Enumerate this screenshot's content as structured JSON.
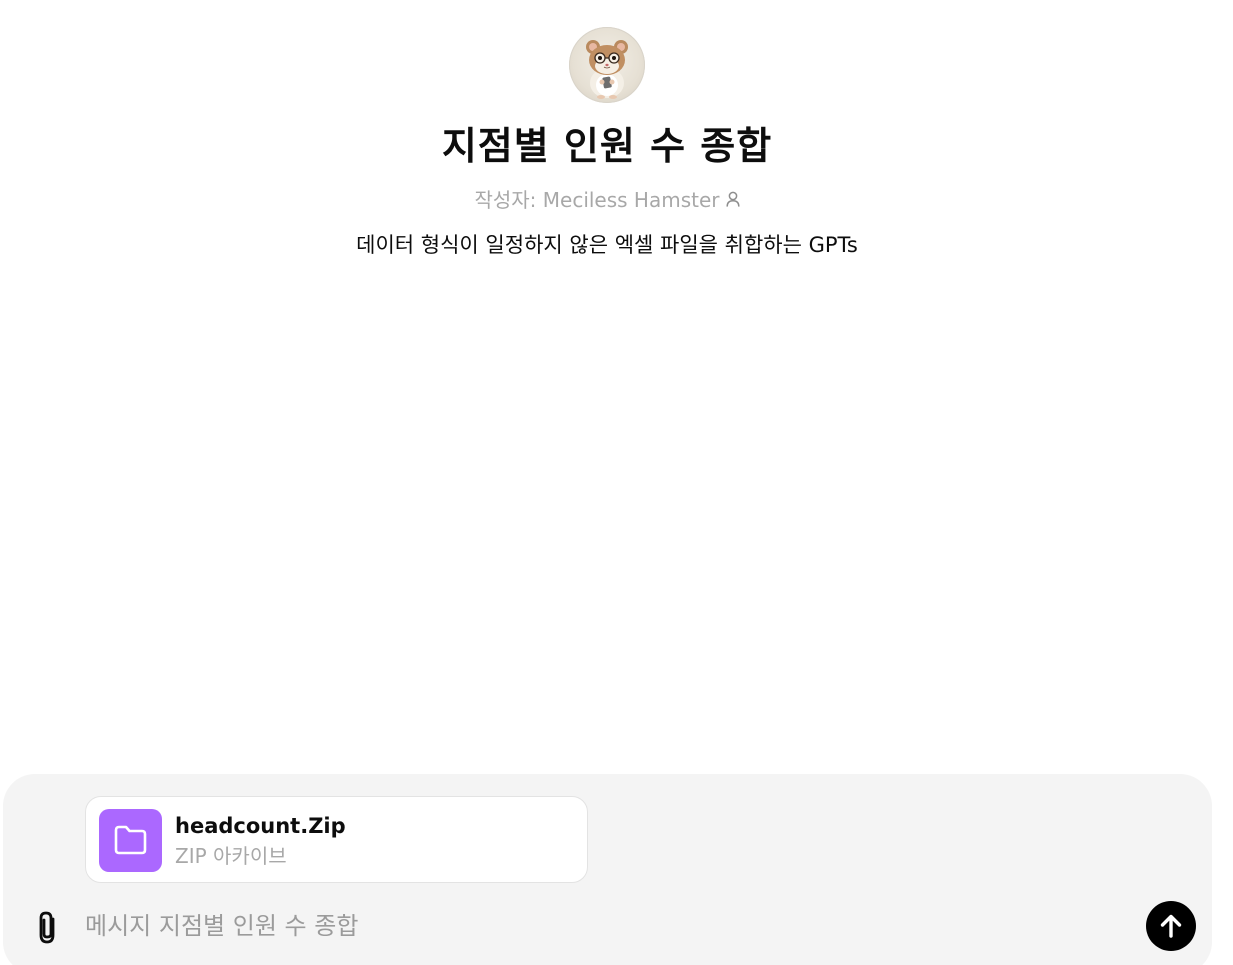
{
  "gpt": {
    "avatar_icon": "hamster-avatar-icon",
    "title": "지점별 인원 수 종합",
    "author_label": "작성자: Meciless Hamster",
    "description": "데이터 형식이 일정하지 않은 엑셀 파일을 취합하는 GPTs"
  },
  "composer": {
    "attachment": {
      "icon": "folder-icon",
      "icon_color": "#ab68ff",
      "name": "headcount.Zip",
      "type": "ZIP 아카이브"
    },
    "placeholder": "메시지 지점별 인원 수 종합",
    "attach_icon": "paperclip-icon",
    "send_icon": "arrow-up-icon"
  },
  "colors": {
    "composer_bg": "#f4f4f4",
    "send_button": "#000000",
    "muted_text": "#a8a8a8"
  }
}
